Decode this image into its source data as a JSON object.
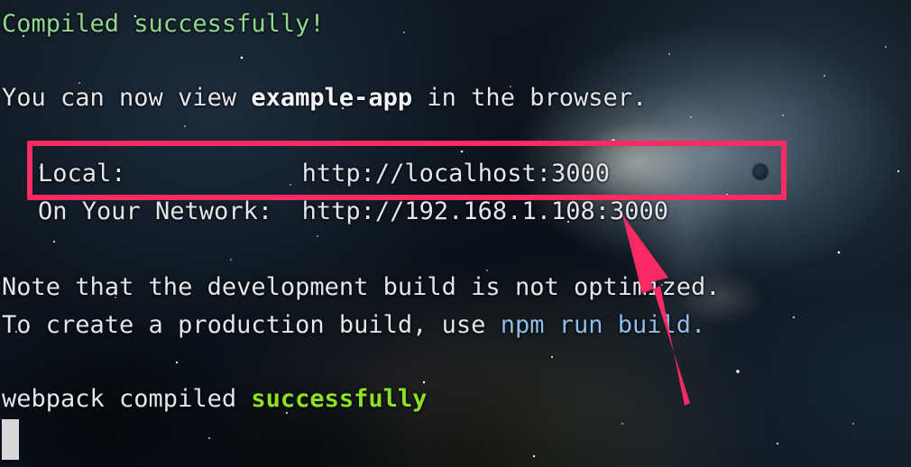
{
  "terminal": {
    "lines": {
      "compiled": "Compiled successfully!",
      "view_prefix": "You can now view ",
      "view_app": "example-app",
      "view_suffix": " in the browser.",
      "local_label": "Local:",
      "local_url": "http://localhost:3000",
      "network_label": "On Your Network:",
      "network_url": "http://192.168.1.108:3000",
      "note": "Note that the development build is not optimized.",
      "prod_prefix": "To create a production build, use ",
      "prod_command": "npm run build",
      "prod_suffix": ".",
      "webpack_prefix": "webpack compiled ",
      "webpack_status": "successfully"
    }
  },
  "annotations": {
    "highlight_box": {
      "name": "local-url-highlight",
      "color": "#fa2b64"
    },
    "arrow": {
      "name": "pink-arrow-pointing-at-local-url",
      "color": "#fa2b64"
    }
  },
  "colors": {
    "success_green": "#8fd98f",
    "lime_green": "#8ee024",
    "command_blue": "#8cbef0",
    "text_white": "#e3e7ec",
    "annotation_pink": "#fa2b64",
    "cursor_gray": "#d8d8d8"
  },
  "icons": {
    "cursor": "block-cursor-icon",
    "pointer": "mouse-pointer-dot-icon"
  }
}
